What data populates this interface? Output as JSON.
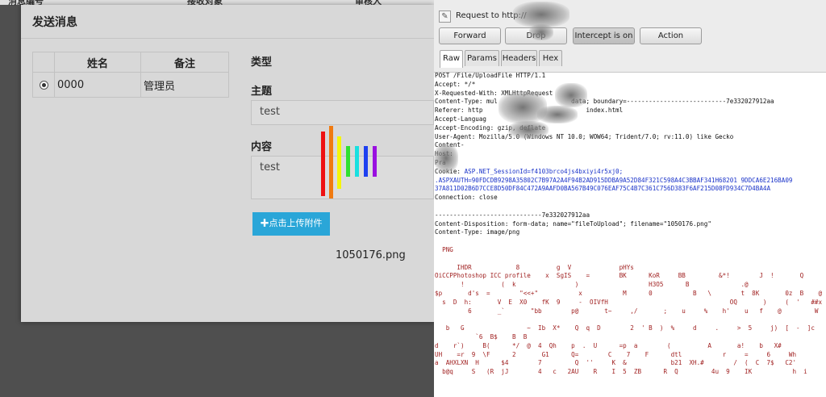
{
  "background_page": {
    "col1": "消息编号",
    "col2": "接收对象",
    "col3": "审核人"
  },
  "modal": {
    "title": "发送消息",
    "table": {
      "headers": [
        "",
        "姓名",
        "备注"
      ],
      "rows": [
        {
          "name": "0000",
          "remark": "管理员",
          "selected": true
        }
      ]
    },
    "type_label": "类型",
    "subject_label": "主题",
    "subject_value": "test",
    "content_label": "内容",
    "content_value": "test",
    "upload_button": "✚点击上传附件",
    "filename": "1050176.png"
  },
  "burp": {
    "request_label": "Request to http://",
    "buttons": {
      "forward": "Forward",
      "drop": "Drop",
      "intercept": "Intercept is on",
      "action": "Action"
    },
    "tabs": [
      "Raw",
      "Params",
      "Headers",
      "Hex"
    ],
    "active_tab": "Raw",
    "lines": [
      "POST /File/UploadFile HTTP/1.1",
      "Accept: */*",
      "X-Requested-With: XMLHttpRequest",
      "Content-Type: mul                    data; boundary=---------------------------7e332027912aa",
      "Referer: http                            index.html",
      "Accept-Languag",
      "Accept-Encoding: gzip, deflate",
      "User-Agent: Mozilla/5.0 (Windows NT 10.0; WOW64; Trident/7.0; rv:11.0) like Gecko",
      "Content-",
      "Host:",
      "Pra",
      "Cookie: ASP.NET_SessionId=f4103brco4js4bxiyi4r5xj0;",
      ".ASPXAUTH=90FDCDB9298A35802C7B97A2A4F94B2AD915DDBA9A52D84F321C598A4C3BBAF341H68201 9DDCA6E216BA09",
      "37A811D02B6D7CCE8D50DF84C472A9AAFD0BA567B49C076EAF75C4B7C361C756D383F6AF215D08FD934C7D4BA4A",
      "Connection: close",
      "",
      "-----------------------------7e332027912aa",
      "Content-Disposition: form-data; name=\"fileToUpload\"; filename=\"1050176.png\"",
      "Content-Type: image/png",
      "",
      "  PNG",
      "",
      "      IHDR            8          g  V             pHYs",
      "OiCCPPhotoshop ICC profile    x  SgIS    =        BK      KoR     BB         &*!        J  !       Q",
      "       !          (  k                )                   H3O5      B              .@",
      "$p       d's  =        \"<<+\"           x           M      0           B   \\        t  8K       0z  B    @",
      "  s  D  h:       V  E  X0    fK  9     -  OIVfH                                 OQ       )     (  '   ##x",
      "         6       _`       \"bb        p@       t~     ,/       ;    u     %    h'    u   f    @         W",
      "",
      "   b   G                 ~  Ib  X*    Q  q  D        2  ' B  )  %     d     .     >  5     j)  [  -  ]c    K'",
      "           `6  B$    B  B",
      "d    r`)     B(      */  @  4  Qh    p  .  U      =p  a        (          A       a!    b   X#             !",
      "UH    =r  9  \\F      2       G1      Q=        C    7    F      dtl           r     =     6     Wh",
      "a  AHXLXN  H      $4        7         Q  ''     K  &            b21  XH.#        /  (  C  7$   C2'",
      "  b@q     S   (R  jJ        4   c   2AU    R    I  5  ZB      R  Q         4u  9    IK           h  i"
    ]
  }
}
